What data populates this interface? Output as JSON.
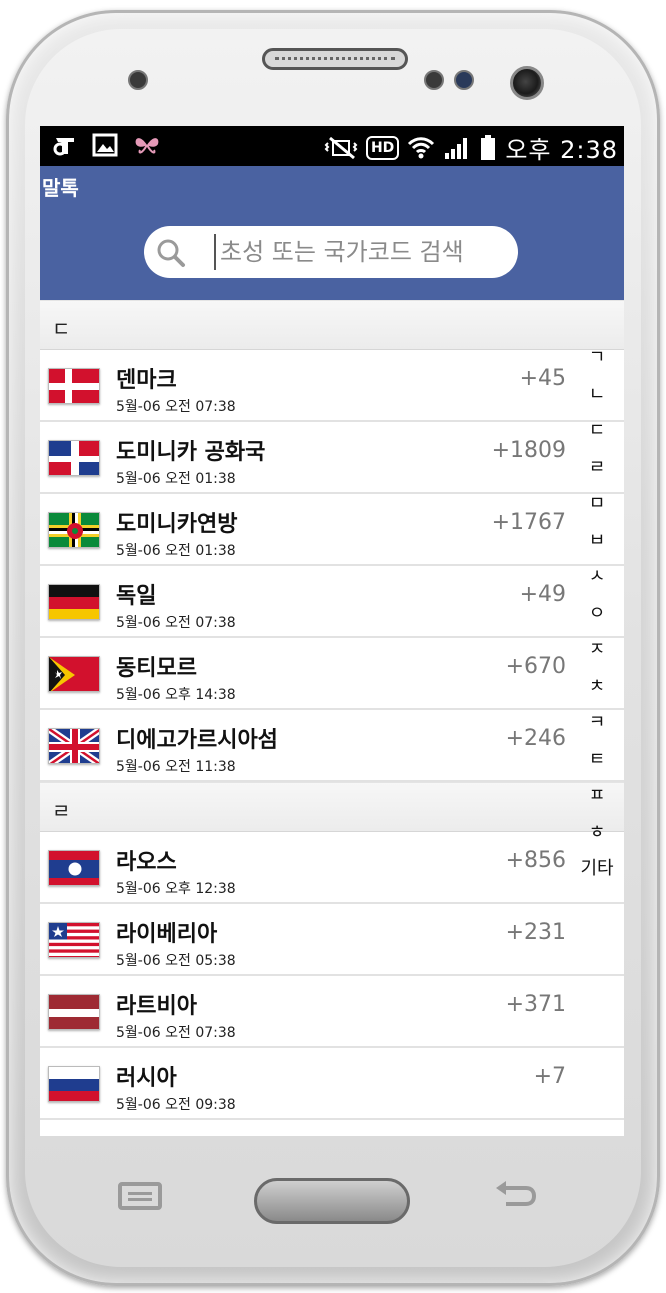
{
  "status_bar": {
    "left_icons": [
      "carrier-icon",
      "gallery-icon",
      "butterfly-icon"
    ],
    "right_icons": [
      "mute-vibrate-icon",
      "hd-icon",
      "wifi-icon",
      "signal-icon",
      "battery-icon"
    ],
    "hd_label": "HD",
    "time": "오후 2:38"
  },
  "app": {
    "title": "말톡",
    "accent_color": "#4a62a1"
  },
  "search": {
    "placeholder": "초성 또는 국가코드 검색"
  },
  "sections": [
    {
      "header": "ㄷ",
      "rows": [
        {
          "name": "덴마크",
          "date": "5월-06 오전 07:38",
          "code": "+45",
          "flag": "denmark"
        },
        {
          "name": "도미니카 공화국",
          "date": "5월-06 오전 01:38",
          "code": "+1809",
          "flag": "dominican-republic"
        },
        {
          "name": "도미니카연방",
          "date": "5월-06 오전 01:38",
          "code": "+1767",
          "flag": "dominica"
        },
        {
          "name": "독일",
          "date": "5월-06 오전 07:38",
          "code": "+49",
          "flag": "germany"
        },
        {
          "name": "동티모르",
          "date": "5월-06 오후 14:38",
          "code": "+670",
          "flag": "east-timor"
        },
        {
          "name": "디에고가르시아섬",
          "date": "5월-06 오전 11:38",
          "code": "+246",
          "flag": "uk"
        }
      ]
    },
    {
      "header": "ㄹ",
      "rows": [
        {
          "name": "라오스",
          "date": "5월-06 오후 12:38",
          "code": "+856",
          "flag": "laos"
        },
        {
          "name": "라이베리아",
          "date": "5월-06 오전 05:38",
          "code": "+231",
          "flag": "liberia"
        },
        {
          "name": "라트비아",
          "date": "5월-06 오전 07:38",
          "code": "+371",
          "flag": "latvia"
        },
        {
          "name": "러시아",
          "date": "5월-06 오전 09:38",
          "code": "+7",
          "flag": "russia"
        }
      ]
    }
  ],
  "index_bar": [
    "ㄱ",
    "ㄴ",
    "ㄷ",
    "ㄹ",
    "ㅁ",
    "ㅂ",
    "ㅅ",
    "ㅇ",
    "ㅈ",
    "ㅊ",
    "ㅋ",
    "ㅌ",
    "ㅍ",
    "ㅎ",
    "기타"
  ],
  "device_buttons": [
    "menu-button",
    "home-button",
    "back-button"
  ]
}
